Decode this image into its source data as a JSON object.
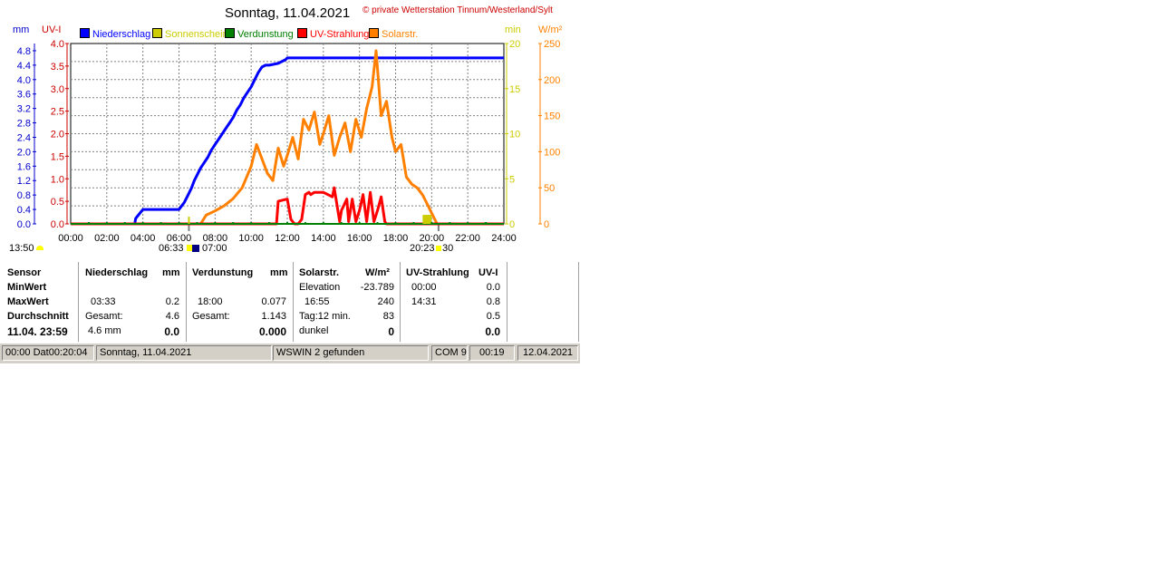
{
  "title": "Sonntag, 11.04.2021",
  "subtitle": "© private Wetterstation Tinnum/Westerland/Sylt",
  "legend": [
    {
      "label": "Niederschlag",
      "color": "#0000ff"
    },
    {
      "label": "Sonnenschein",
      "color": "#cccc00"
    },
    {
      "label": "Verdunstung",
      "color": "#008000"
    },
    {
      "label": "UV-Strahlung",
      "color": "#ff0000"
    },
    {
      "label": "Solarstr.",
      "color": "#ff8000"
    }
  ],
  "axis_titles": {
    "mm": "mm",
    "uv": "UV-I",
    "min": "min",
    "wm2": "W/m²"
  },
  "sun_labels": {
    "now": "13:50",
    "sunrise": "06:33",
    "daybreak": "07:00",
    "sunset": "20:23",
    "dusk": "30"
  },
  "chart_data": {
    "type": "line",
    "x_ticks": [
      "00:00",
      "02:00",
      "04:00",
      "06:00",
      "08:00",
      "10:00",
      "12:00",
      "14:00",
      "16:00",
      "18:00",
      "20:00",
      "22:00",
      "24:00"
    ],
    "xlim": [
      0,
      24
    ],
    "axes": {
      "mm": {
        "ticks": [
          "0.0",
          "0.4",
          "0.8",
          "1.2",
          "1.6",
          "2.0",
          "2.4",
          "2.8",
          "3.2",
          "3.6",
          "4.0",
          "4.4",
          "4.8"
        ],
        "ylim": [
          0,
          5.0
        ],
        "color": "#0000cc"
      },
      "uv": {
        "ticks": [
          "0.0",
          "0.5",
          "1.0",
          "1.5",
          "2.0",
          "2.5",
          "3.0",
          "3.5",
          "4.0"
        ],
        "ylim": [
          0,
          4.0
        ],
        "color": "#cc0000"
      },
      "min": {
        "ticks": [
          "0",
          "5",
          "10",
          "15",
          "20"
        ],
        "ylim": [
          0,
          20
        ],
        "color": "#cccc00"
      },
      "wm2": {
        "ticks": [
          "0",
          "50",
          "100",
          "150",
          "200",
          "250"
        ],
        "ylim": [
          0,
          250
        ],
        "color": "#ff8000"
      }
    },
    "grid": true,
    "series": [
      {
        "name": "Niederschlag",
        "axis": "mm",
        "color": "#0000ff",
        "x": [
          0,
          3.55,
          3.6,
          4.0,
          6.0,
          6.3,
          6.5,
          6.7,
          6.85,
          7.0,
          7.2,
          7.4,
          7.6,
          7.8,
          8.0,
          8.2,
          8.4,
          8.6,
          8.8,
          9.0,
          9.2,
          9.4,
          9.6,
          9.8,
          10.0,
          10.2,
          10.4,
          10.6,
          10.8,
          11.0,
          11.5,
          11.9,
          12.0,
          24.0
        ],
        "y": [
          0,
          0,
          0.15,
          0.4,
          0.4,
          0.6,
          0.8,
          1.0,
          1.2,
          1.35,
          1.55,
          1.7,
          1.85,
          2.05,
          2.2,
          2.35,
          2.5,
          2.65,
          2.8,
          2.95,
          3.15,
          3.3,
          3.5,
          3.65,
          3.8,
          4.0,
          4.2,
          4.35,
          4.4,
          4.4,
          4.45,
          4.55,
          4.6,
          4.6
        ]
      },
      {
        "name": "Solarstr.",
        "axis": "wm2",
        "color": "#ff8000",
        "x": [
          0,
          7.2,
          7.5,
          8.0,
          8.5,
          9.0,
          9.5,
          10.0,
          10.3,
          10.6,
          10.9,
          11.2,
          11.5,
          11.8,
          12.0,
          12.3,
          12.6,
          12.9,
          13.2,
          13.5,
          13.8,
          14.0,
          14.3,
          14.6,
          14.9,
          15.2,
          15.5,
          15.8,
          16.1,
          16.4,
          16.7,
          16.92,
          17.2,
          17.5,
          17.8,
          18.0,
          18.3,
          18.6,
          18.9,
          19.2,
          19.5,
          19.8,
          20.0,
          20.3,
          24.0
        ],
        "y": [
          0,
          0,
          12,
          18,
          25,
          35,
          50,
          80,
          110,
          90,
          70,
          60,
          105,
          80,
          95,
          120,
          90,
          145,
          130,
          155,
          110,
          125,
          150,
          95,
          120,
          140,
          100,
          145,
          120,
          160,
          190,
          240,
          150,
          170,
          120,
          100,
          110,
          65,
          55,
          50,
          40,
          25,
          15,
          0,
          0
        ]
      },
      {
        "name": "UV-Strahlung",
        "axis": "uv",
        "color": "#ff0000",
        "x": [
          0,
          11.4,
          11.5,
          12.0,
          12.2,
          12.4,
          12.6,
          12.8,
          13.0,
          13.2,
          13.3,
          13.5,
          14.0,
          14.5,
          14.6,
          14.9,
          15.0,
          15.3,
          15.4,
          15.6,
          15.8,
          16.0,
          16.2,
          16.4,
          16.6,
          16.8,
          17.0,
          17.2,
          17.4,
          17.5,
          24.0
        ],
        "y": [
          0,
          0,
          0.5,
          0.55,
          0.1,
          0,
          0,
          0.1,
          0.65,
          0.7,
          0.65,
          0.7,
          0.7,
          0.6,
          0.8,
          0.05,
          0.3,
          0.55,
          0.05,
          0.55,
          0.05,
          0.3,
          0.65,
          0.05,
          0.7,
          0.05,
          0.3,
          0.6,
          0.05,
          0,
          0
        ]
      },
      {
        "name": "Verdunstung",
        "axis": "mm",
        "color": "#008000",
        "x": [
          0,
          24
        ],
        "y": [
          0,
          0
        ]
      },
      {
        "name": "Sonnenschein",
        "axis": "min",
        "color": "#cccc00",
        "x": [
          6.5,
          6.6,
          19.5,
          20.0
        ],
        "y": [
          0.8,
          0.6,
          1.0,
          0.8
        ]
      }
    ]
  },
  "table": {
    "row_labels": [
      "Sensor",
      "MinWert",
      "MaxWert",
      "Durchschnitt",
      "11.04.  23:59"
    ],
    "niederschlag": {
      "header": "Niederschlag",
      "unit": "mm",
      "max_time": "03:33",
      "max_val": "0.2",
      "sum_label": "Gesamt:",
      "sum_val": "4.6",
      "day_label": "4.6 mm",
      "day_val": "0.0"
    },
    "verdunstung": {
      "header": "Verdunstung",
      "unit": "mm",
      "max_time": "18:00",
      "max_val": "0.077",
      "sum_label": "Gesamt:",
      "sum_val": "1.143",
      "day_val": "0.000"
    },
    "solar": {
      "header": "Solarstr.",
      "unit": "W/m²",
      "min_label": "Elevation",
      "min_val": "-23.789",
      "max_time": "16:55",
      "max_val": "240",
      "avg_label": "Tag:12 min.",
      "avg_val": "83",
      "day_label": "dunkel",
      "day_val": "0"
    },
    "uv": {
      "header": "UV-Strahlung",
      "unit": "UV-I",
      "min_time": "00:00",
      "min_val": "0.0",
      "max_time": "14:31",
      "max_val": "0.8",
      "avg_val": "0.5",
      "day_val": "0.0"
    }
  },
  "status": {
    "date_field": "00:00  Dat00:20:04",
    "day": "Sonntag, 11.04.2021",
    "device": "WSWIN 2 gefunden",
    "port": "COM 9",
    "time": "00:19",
    "date": "12.04.2021"
  }
}
